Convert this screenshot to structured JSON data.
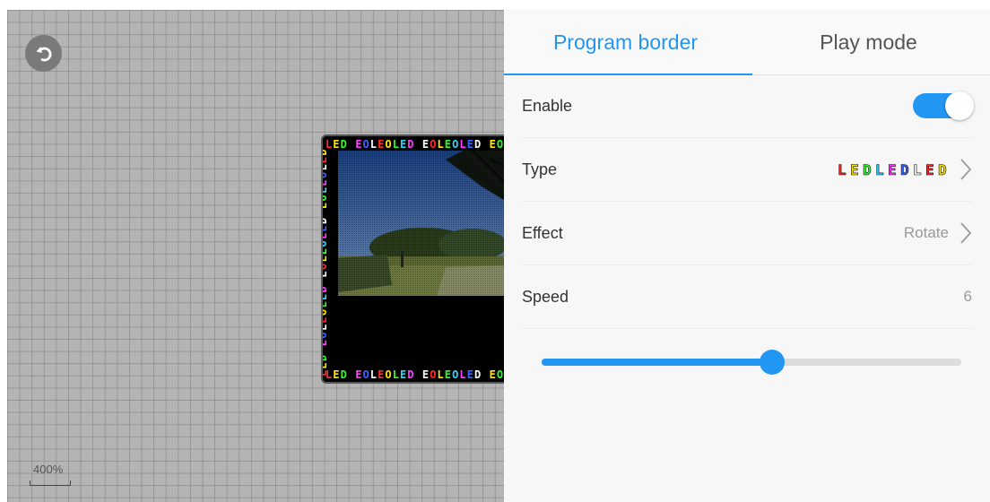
{
  "canvas": {
    "zoom_label": "400%",
    "border_text_top": "LED EOLEOLED EOLEOLED EOL",
    "border_text_left": "LED EOLEOLED EOLEOLED EOLEOLED",
    "border_text_bottom": "LED EOLEOLED EOLEOLED EOL"
  },
  "tabs": [
    {
      "label": "Program border",
      "active": true
    },
    {
      "label": "Play mode",
      "active": false
    }
  ],
  "settings": {
    "enable": {
      "label": "Enable",
      "value": true
    },
    "type": {
      "label": "Type",
      "preview_text": "LEDLEDLED"
    },
    "effect": {
      "label": "Effect",
      "value": "Rotate"
    },
    "speed": {
      "label": "Speed",
      "value": "6",
      "slider_fraction": 0.55
    }
  },
  "colors": {
    "accent": "#2196f3",
    "canvas_bg": "#b4b4b4",
    "border_palette": [
      "#ff2a2a",
      "#ffe600",
      "#2aff2a",
      "#29d7ff",
      "#ff3cff",
      "#3c64ff",
      "#ffffff"
    ]
  },
  "icons": {
    "undo": "undo-icon",
    "chevron": "chevron-right-icon"
  }
}
